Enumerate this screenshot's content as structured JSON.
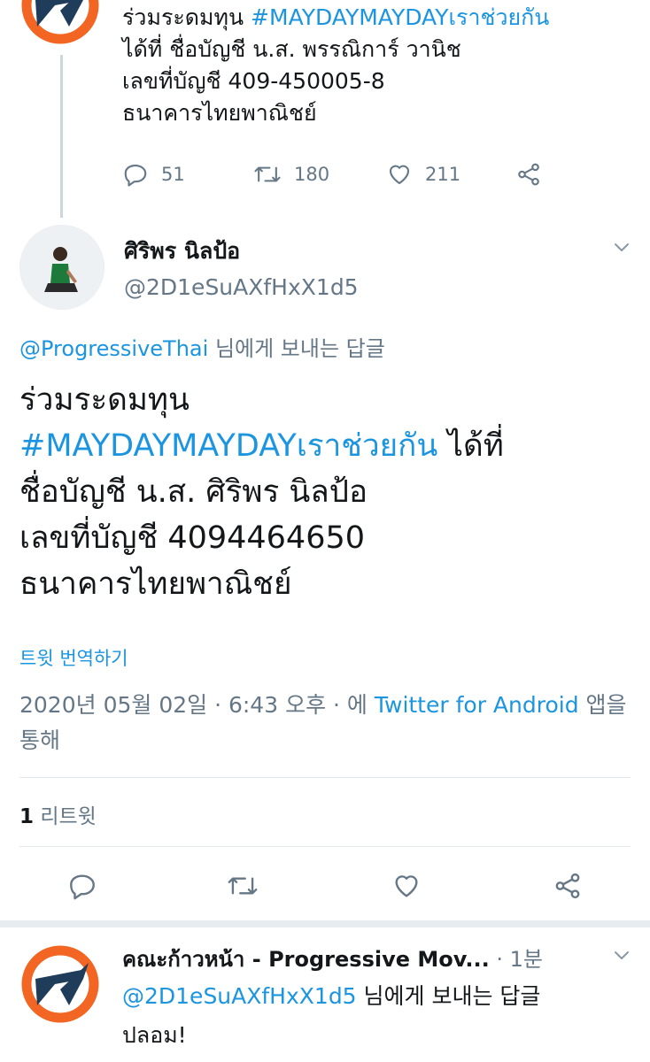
{
  "prev_tweet": {
    "text_prefix": "ร่วมระดมทุน ",
    "hashtag": "#MAYDAYMAYDAYเราช่วยกัน",
    "line2": "ได้ที่ ชื่อบัญชี น.ส. พรรณิการ์ วานิช",
    "line3": "เลขที่บัญชี 409-450005-8",
    "line4": "ธนาคารไทยพาณิชย์",
    "replies": "51",
    "retweets": "180",
    "likes": "211"
  },
  "main_tweet": {
    "display_name": "ศิริพร นิลป้อ",
    "handle": "@2D1eSuAXfHxX1d5",
    "reply_to_handle": "@ProgressiveThai",
    "reply_to_suffix": " 님에게 보내는 답글",
    "text_line1": "ร่วมระดมทุน",
    "hashtag": "#MAYDAYMAYDAYเราช่วยกัน",
    "text_after_hashtag": " ได้ที่",
    "text_line3": "ชื่อบัญชี น.ส. ศิริพร นิลป้อ",
    "text_line4": "เลขที่บัญชี  4094464650",
    "text_line5": "ธนาคารไทยพาณิชย์",
    "translate": "트윗 번역하기",
    "timestamp": "2020년 05월 02일 · 6:43 오후 · 에 ",
    "source_link": "Twitter for Android",
    "source_suffix": " 앱을 통해",
    "retweet_count": "1",
    "retweet_label": " 리트윗"
  },
  "reply_tweet": {
    "display_name": "คณะก้าวหน้า - Progressive Mov...",
    "time": " · 1분",
    "reply_to_handle": "@2D1eSuAXfHxX1d5",
    "reply_to_suffix": " 님에게 보내는 답글",
    "text": "ปลอม!"
  },
  "colors": {
    "link": "#1b95e0",
    "secondary": "#657786",
    "logo_orange": "#f26522",
    "logo_navy": "#1f3c5a"
  }
}
